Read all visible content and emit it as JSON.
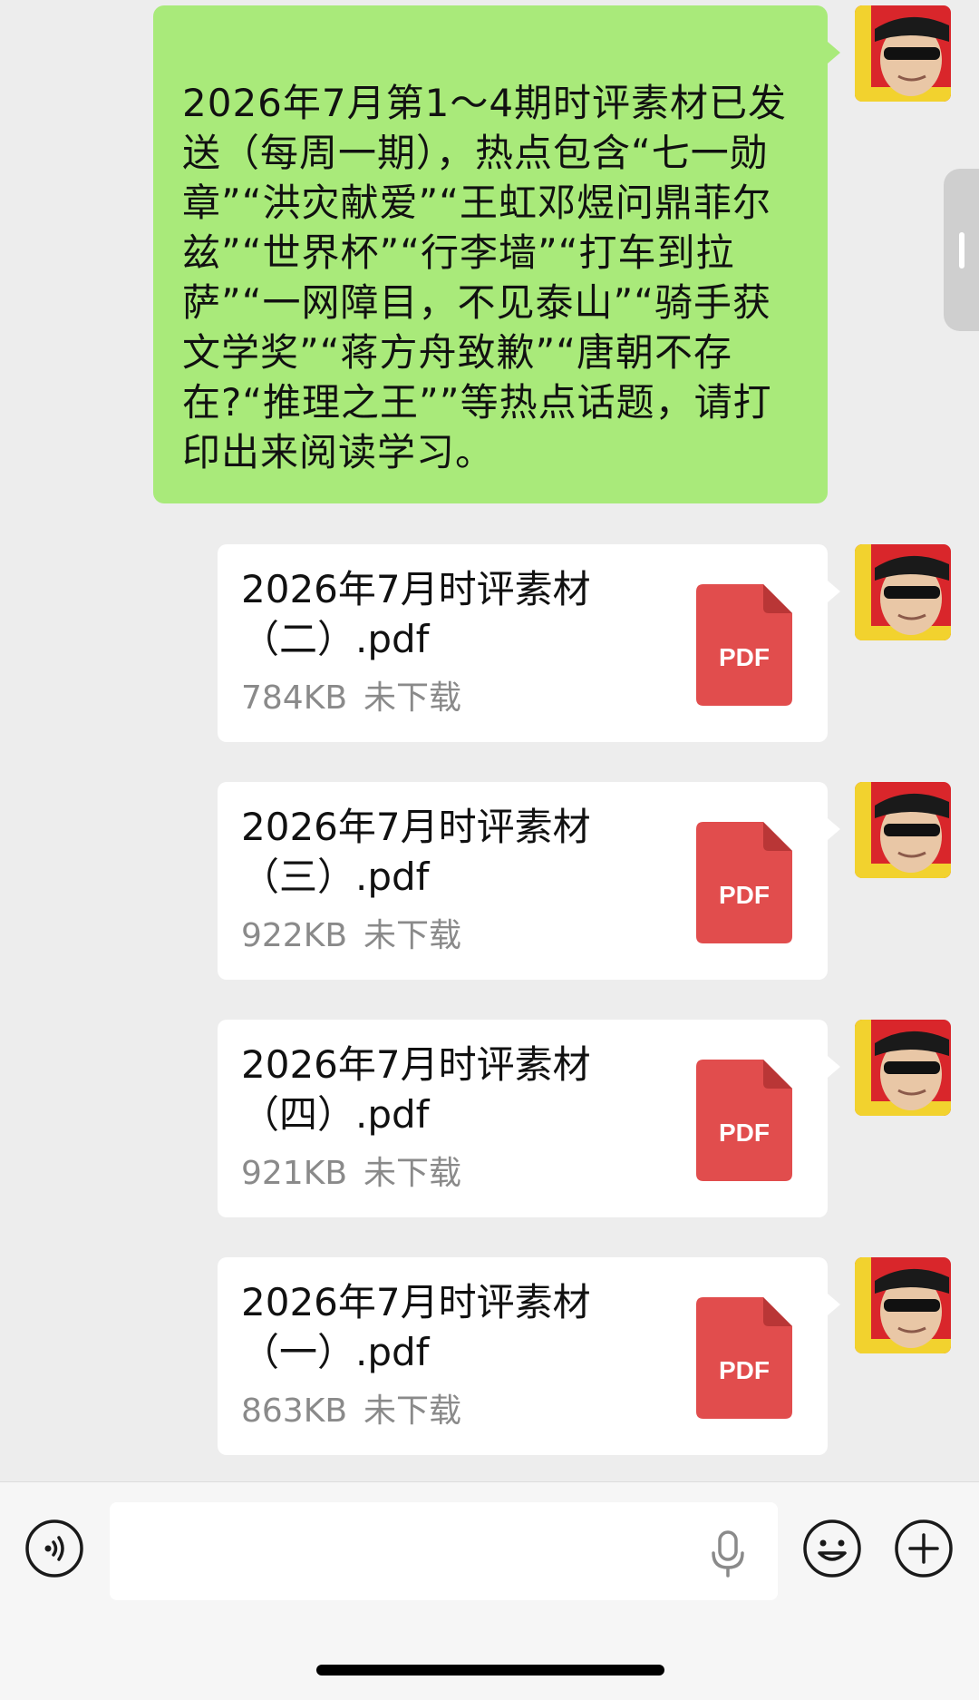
{
  "messages": {
    "text": "2026年7月第1～4期时评素材已发送（每周一期），热点包含“七一勋章”“洪灾献爱”“王虹邓煜问鼎菲尔兹”“世界杯”“行李墙”“打车到拉萨”“一网障目，不见泰山”“骑手获文学奖”“蒋方舟致歉”“唐朝不存在?“推理之王””等热点话题，请打印出来阅读学习。",
    "files": [
      {
        "name": "2026年7月时评素材\n（二）.pdf",
        "size": "784KB",
        "status": "未下载",
        "icon_label": "PDF"
      },
      {
        "name": "2026年7月时评素材\n（三）.pdf",
        "size": "922KB",
        "status": "未下载",
        "icon_label": "PDF"
      },
      {
        "name": "2026年7月时评素材\n（四）.pdf",
        "size": "921KB",
        "status": "未下载",
        "icon_label": "PDF"
      },
      {
        "name": "2026年7月时评素材\n（一）.pdf",
        "size": "863KB",
        "status": "未下载",
        "icon_label": "PDF"
      }
    ]
  },
  "colors": {
    "chat_background": "#ededed",
    "sent_bubble": "#a9ea7a",
    "file_card": "#ffffff",
    "pdf_icon": "#e14d4d",
    "meta_text": "#8a8a8a"
  },
  "input_bar": {
    "voice_icon": "voice-icon",
    "mic_icon": "microphone-icon",
    "emoji_icon": "emoji-icon",
    "plus_icon": "plus-icon",
    "input_value": ""
  }
}
